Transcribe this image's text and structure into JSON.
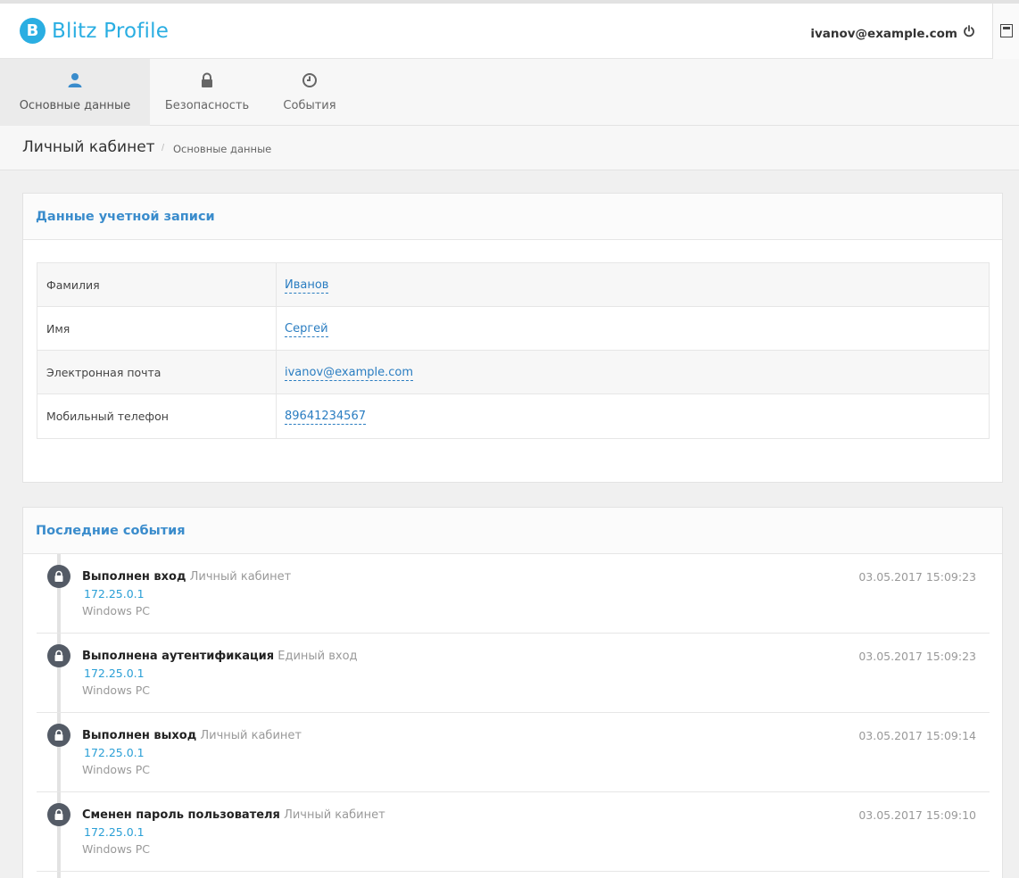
{
  "app": {
    "logo_letter": "B",
    "title": "Blitz Profile",
    "user_email": "ivanov@example.com"
  },
  "icons": {
    "power": "power-icon",
    "sidebar_toggle": "sidebar-toggle-icon",
    "tab_main": "user-icon",
    "tab_security": "lock-icon",
    "tab_events": "clock-icon",
    "event": "lock-icon"
  },
  "colors": {
    "brand": "#2aaee2",
    "link": "#2a7dc1",
    "panel_title": "#3a8ccc",
    "active_tab_icon": "#3a8ccc"
  },
  "tabs": [
    {
      "label": "Основные данные",
      "active": true
    },
    {
      "label": "Безопасность",
      "active": false
    },
    {
      "label": "События",
      "active": false
    }
  ],
  "breadcrumb": {
    "title": "Личный кабинет",
    "separator": "/",
    "current": "Основные данные"
  },
  "account": {
    "title": "Данные учетной записи",
    "rows": [
      {
        "label": "Фамилия",
        "value": "Иванов"
      },
      {
        "label": "Имя",
        "value": "Сергей"
      },
      {
        "label": "Электронная почта",
        "value": "ivanov@example.com"
      },
      {
        "label": "Мобильный телефон",
        "value": "89641234567"
      }
    ]
  },
  "events": {
    "title": "Последние события",
    "items": [
      {
        "action": "Выполнен вход",
        "source": "Личный кабинет",
        "ip": "172.25.0.1",
        "device": "Windows PC",
        "time": "03.05.2017 15:09:23"
      },
      {
        "action": "Выполнена аутентификация",
        "source": "Единый вход",
        "ip": "172.25.0.1",
        "device": "Windows PC",
        "time": "03.05.2017 15:09:23"
      },
      {
        "action": "Выполнен выход",
        "source": "Личный кабинет",
        "ip": "172.25.0.1",
        "device": "Windows PC",
        "time": "03.05.2017 15:09:14"
      },
      {
        "action": "Сменен пароль пользователя",
        "source": "Личный кабинет",
        "ip": "172.25.0.1",
        "device": "Windows PC",
        "time": "03.05.2017 15:09:10"
      }
    ]
  }
}
